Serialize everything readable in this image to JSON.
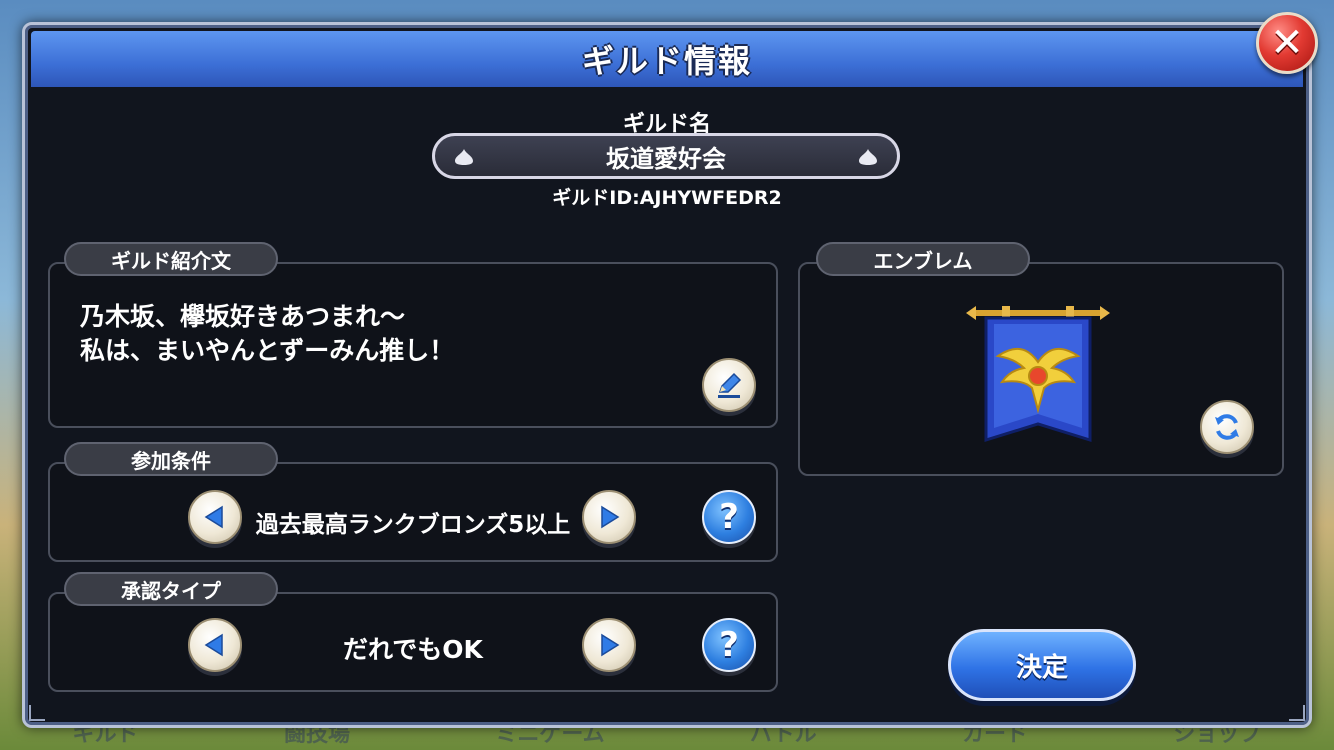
{
  "background": {
    "tabs": [
      "ギルド",
      "闘技場",
      "ミニゲーム",
      "バトル",
      "カード",
      "ショップ"
    ]
  },
  "dialog": {
    "title": "ギルド情報",
    "close_label": "✕"
  },
  "guild": {
    "name_label": "ギルド名",
    "name": "坂道愛好会",
    "id_text": "ギルドID:AJHYWFEDR2"
  },
  "intro": {
    "label": "ギルド紹介文",
    "text": "乃木坂、欅坂好きあつまれ〜\n私は、まいやんとずーみん推し！"
  },
  "emblem": {
    "label": "エンブレム"
  },
  "condition": {
    "label": "参加条件",
    "value": "過去最高ランクブロンズ5以上"
  },
  "approval": {
    "label": "承認タイプ",
    "value": "だれでもOK"
  },
  "help_glyph": "?",
  "confirm": {
    "label": "決定"
  },
  "colors": {
    "header_blue": "#3c6fd6",
    "panel_bg": "#11151e",
    "close_red": "#e23a32",
    "confirm_blue": "#2f73e6"
  }
}
